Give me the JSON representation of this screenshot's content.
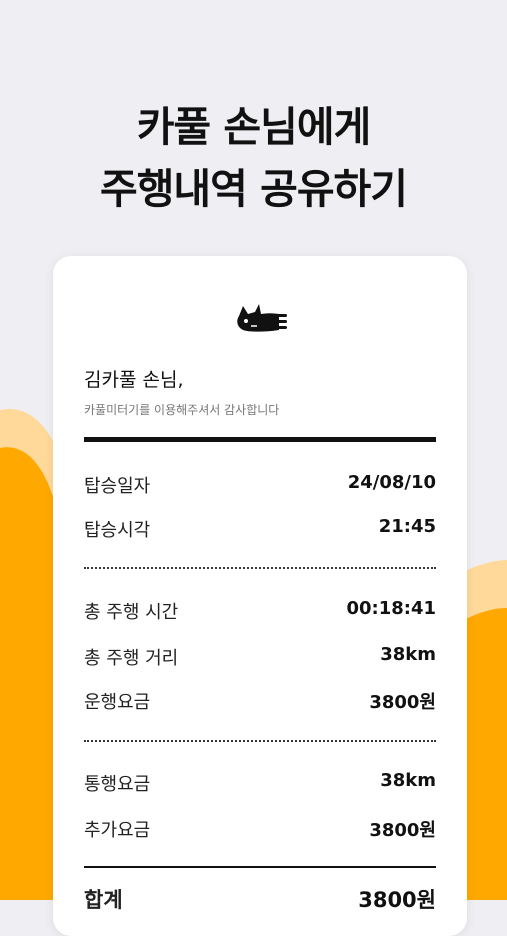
{
  "headline": {
    "line1": "카풀 손님에게",
    "line2": "주행내역 공유하기"
  },
  "colors": {
    "accent": "#ffa800",
    "accent_light": "#ffd99a",
    "background": "#efeff3"
  },
  "receipt": {
    "logo_icon": "flying-cat-icon",
    "greeting": "김카풀 손님,",
    "subtext": "카풀미터기를 이용해주셔서 감사합니다",
    "boarding": [
      {
        "label": "탑승일자",
        "value": "24/08/10"
      },
      {
        "label": "탑승시각",
        "value": "21:45"
      }
    ],
    "trip": [
      {
        "label": "총 주행 시간",
        "value": "00:18:41"
      },
      {
        "label": "총 주행 거리",
        "value": "38km"
      },
      {
        "label": "운행요금",
        "value": "3800원"
      }
    ],
    "extra": [
      {
        "label": "통행요금",
        "value": "38km"
      },
      {
        "label": "추가요금",
        "value": "3800원"
      }
    ],
    "total": {
      "label": "합계",
      "value": "3800원"
    }
  }
}
